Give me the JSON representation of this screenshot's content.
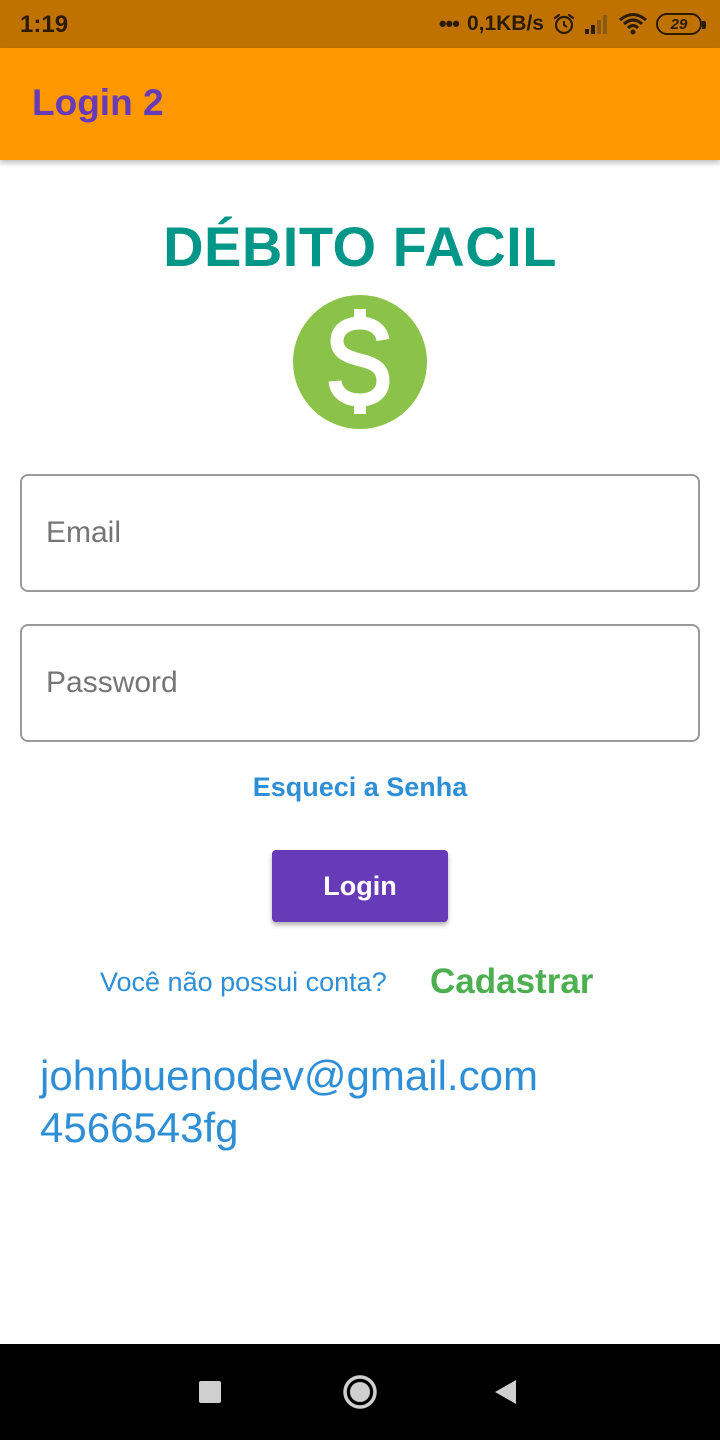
{
  "status_bar": {
    "time": "1:19",
    "dots": "•••",
    "network_speed": "0,1KB/s",
    "battery_level": "29"
  },
  "app_bar": {
    "title": "Login 2"
  },
  "brand": {
    "title": "DÉBITO FACIL",
    "icon": "dollar-circle-icon",
    "icon_color": "#8bc34a"
  },
  "form": {
    "email_placeholder": "Email",
    "email_value": "",
    "password_placeholder": "Password",
    "password_value": ""
  },
  "links": {
    "forgot_password": "Esqueci a Senha",
    "no_account": "Você não possui conta?",
    "signup": "Cadastrar"
  },
  "buttons": {
    "login": "Login"
  },
  "debug_output": {
    "email": "johnbuenodev@gmail.com",
    "password": "4566543fg"
  },
  "colors": {
    "status_bar": "#bf7200",
    "app_bar": "#ff9800",
    "title_purple": "#673ab7",
    "brand_teal": "#009688",
    "link_blue": "#2e8fd6",
    "signup_green": "#4caf50"
  },
  "nav_bar": {
    "recents_icon": "square-icon",
    "home_icon": "circle-icon",
    "back_icon": "triangle-back-icon"
  }
}
